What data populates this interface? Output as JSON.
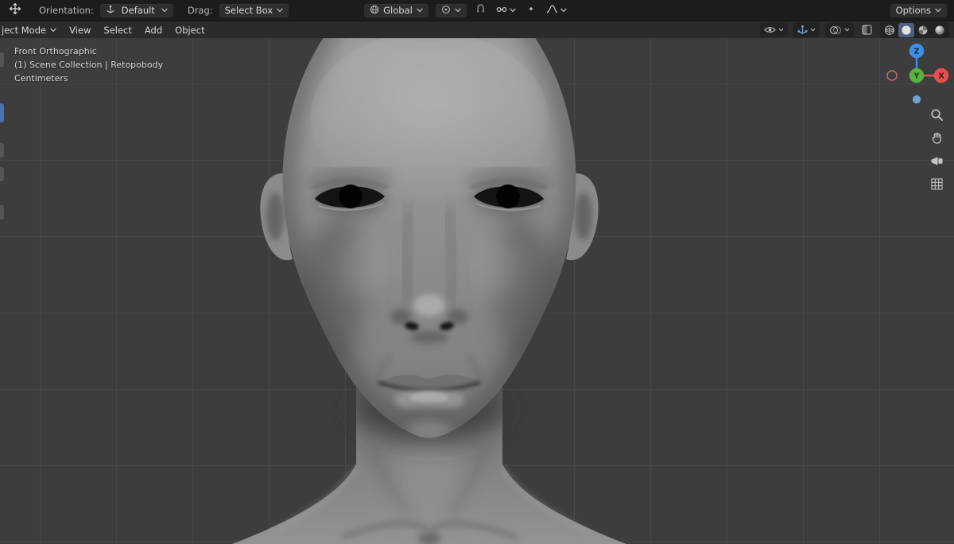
{
  "topbar": {
    "orientation_label": "Orientation:",
    "orientation_value": "Default",
    "drag_label": "Drag:",
    "drag_value": "Select Box",
    "transform_orientation_value": "Global",
    "options_label": "Options"
  },
  "header": {
    "mode_value": "ject Mode",
    "menus": [
      {
        "label": "View"
      },
      {
        "label": "Select"
      },
      {
        "label": "Add"
      },
      {
        "label": "Object"
      }
    ]
  },
  "viewport": {
    "view_name": "Front Orthographic",
    "scene_info": "(1) Scene Collection | Retopobody",
    "units": "Centimeters",
    "axes": {
      "x": "X",
      "y": "Y",
      "z": "Z"
    }
  },
  "colors": {
    "topbar_bg": "#1c1c1c",
    "header_bg": "#2b2b2b",
    "viewport_bg": "#3d3d3d",
    "grid_line": "#474747",
    "accent_blue": "#4772b3",
    "axis_x": "#e8504f",
    "axis_y": "#58b33c",
    "axis_z": "#3f8fe8"
  }
}
